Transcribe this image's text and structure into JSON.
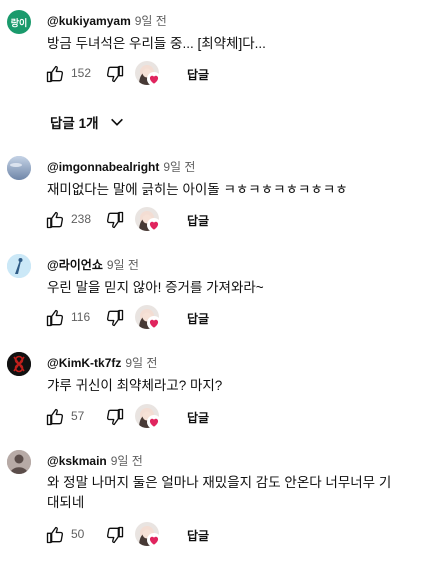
{
  "comments": [
    {
      "author": "@kukiyamyam",
      "time": "9일 전",
      "avatar_text": "랑이",
      "text": "방금 두녀석은 우리들 중... [최약체]다...",
      "likes": "152",
      "reply_label": "답글",
      "replies_toggle": "답글 1개"
    },
    {
      "author": "@imgonnabealright",
      "time": "9일 전",
      "text": "재미없다는 말에 긁히는 아이돌 ㅋㅎㅋㅎㅋㅎㅋㅎㅋㅎ",
      "likes": "238",
      "reply_label": "답글"
    },
    {
      "author": "@라이언쇼",
      "time": "9일 전",
      "text": "우린 말을 믿지 않아! 증거를 가져와라~",
      "likes": "116",
      "reply_label": "답글"
    },
    {
      "author": "@KimK-tk7fz",
      "time": "9일 전",
      "text": "갸루 귀신이 최약체라고? 마지?",
      "likes": "57",
      "reply_label": "답글"
    },
    {
      "author": "@kskmain",
      "time": "9일 전",
      "text_line1": "와 정말 나머지 둘은 얼마나 재밌을지 감도 안온다 너무너무 기",
      "text_line2": "대되네",
      "likes": "50",
      "reply_label": "답글"
    }
  ],
  "colors": {
    "avatar1": "#1a9a6c",
    "heart": "#e0245e",
    "secondary_text": "#606060"
  },
  "icons": [
    "thumbs-up-icon",
    "thumbs-down-icon",
    "heart-icon",
    "chevron-down-icon"
  ]
}
